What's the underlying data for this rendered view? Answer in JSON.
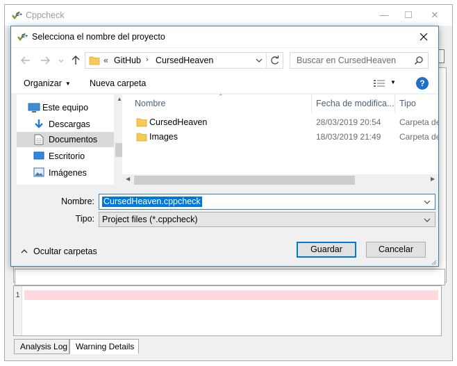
{
  "background_window": {
    "title": "Cppcheck",
    "code_line_number": "1",
    "tabs": [
      "Analysis Log",
      "Warning Details"
    ],
    "active_tab_index": 1
  },
  "dialog": {
    "title": "Selecciona el nombre del proyecto",
    "breadcrumb": {
      "overflow": "«",
      "items": [
        "GitHub",
        "CursedHeaven"
      ]
    },
    "search": {
      "placeholder": "Buscar en CursedHeaven"
    },
    "toolbar": {
      "organize_label": "Organizar",
      "new_folder_label": "Nueva carpeta",
      "help_label": "?"
    },
    "nav_pane": {
      "items": [
        {
          "label": "Este equipo",
          "icon": "computer-icon"
        },
        {
          "label": "Descargas",
          "icon": "download-icon"
        },
        {
          "label": "Documentos",
          "icon": "document-icon"
        },
        {
          "label": "Escritorio",
          "icon": "desktop-icon"
        },
        {
          "label": "Imágenes",
          "icon": "pictures-icon"
        }
      ],
      "selected_index": 2
    },
    "file_list": {
      "columns": [
        "Nombre",
        "Fecha de modifica...",
        "Tipo"
      ],
      "rows": [
        {
          "name": "CursedHeaven",
          "date": "28/03/2019 20:54",
          "type": "Carpeta de archivos"
        },
        {
          "name": "Images",
          "date": "18/03/2019 21:49",
          "type": "Carpeta de archivos"
        }
      ]
    },
    "filename": {
      "label": "Nombre:",
      "value": "CursedHeaven.cppcheck"
    },
    "filetype": {
      "label": "Tipo:",
      "value": "Project files (*.cppcheck)"
    },
    "hide_folders_label": "Ocultar carpetas",
    "save_label": "Guardar",
    "cancel_label": "Cancelar"
  },
  "colors": {
    "accent": "#0078d7",
    "help_icon": "#1e6fc8",
    "error_line": "#ffd9dd",
    "folder": "#f8c955"
  }
}
